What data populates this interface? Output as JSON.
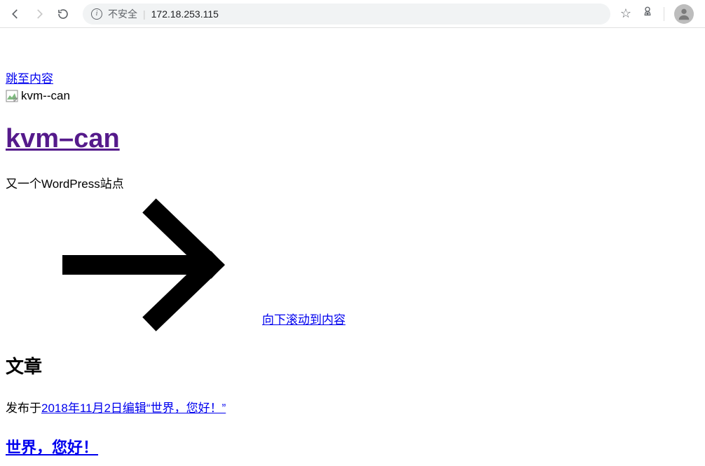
{
  "browser": {
    "insecure_label": "不安全",
    "url": "172.18.253.115"
  },
  "page": {
    "skip_link": "跳至内容",
    "broken_img_alt": "kvm--can",
    "site_title": "kvm–can",
    "tagline": "又一个WordPress站点",
    "scroll_down": "向下滚动到内容",
    "section_heading": "文章",
    "post_prefix": "发布于",
    "post_date": "2018年11月2日",
    "post_edit": "编辑“世界，您好！”",
    "post_title": "世界，您好！"
  }
}
